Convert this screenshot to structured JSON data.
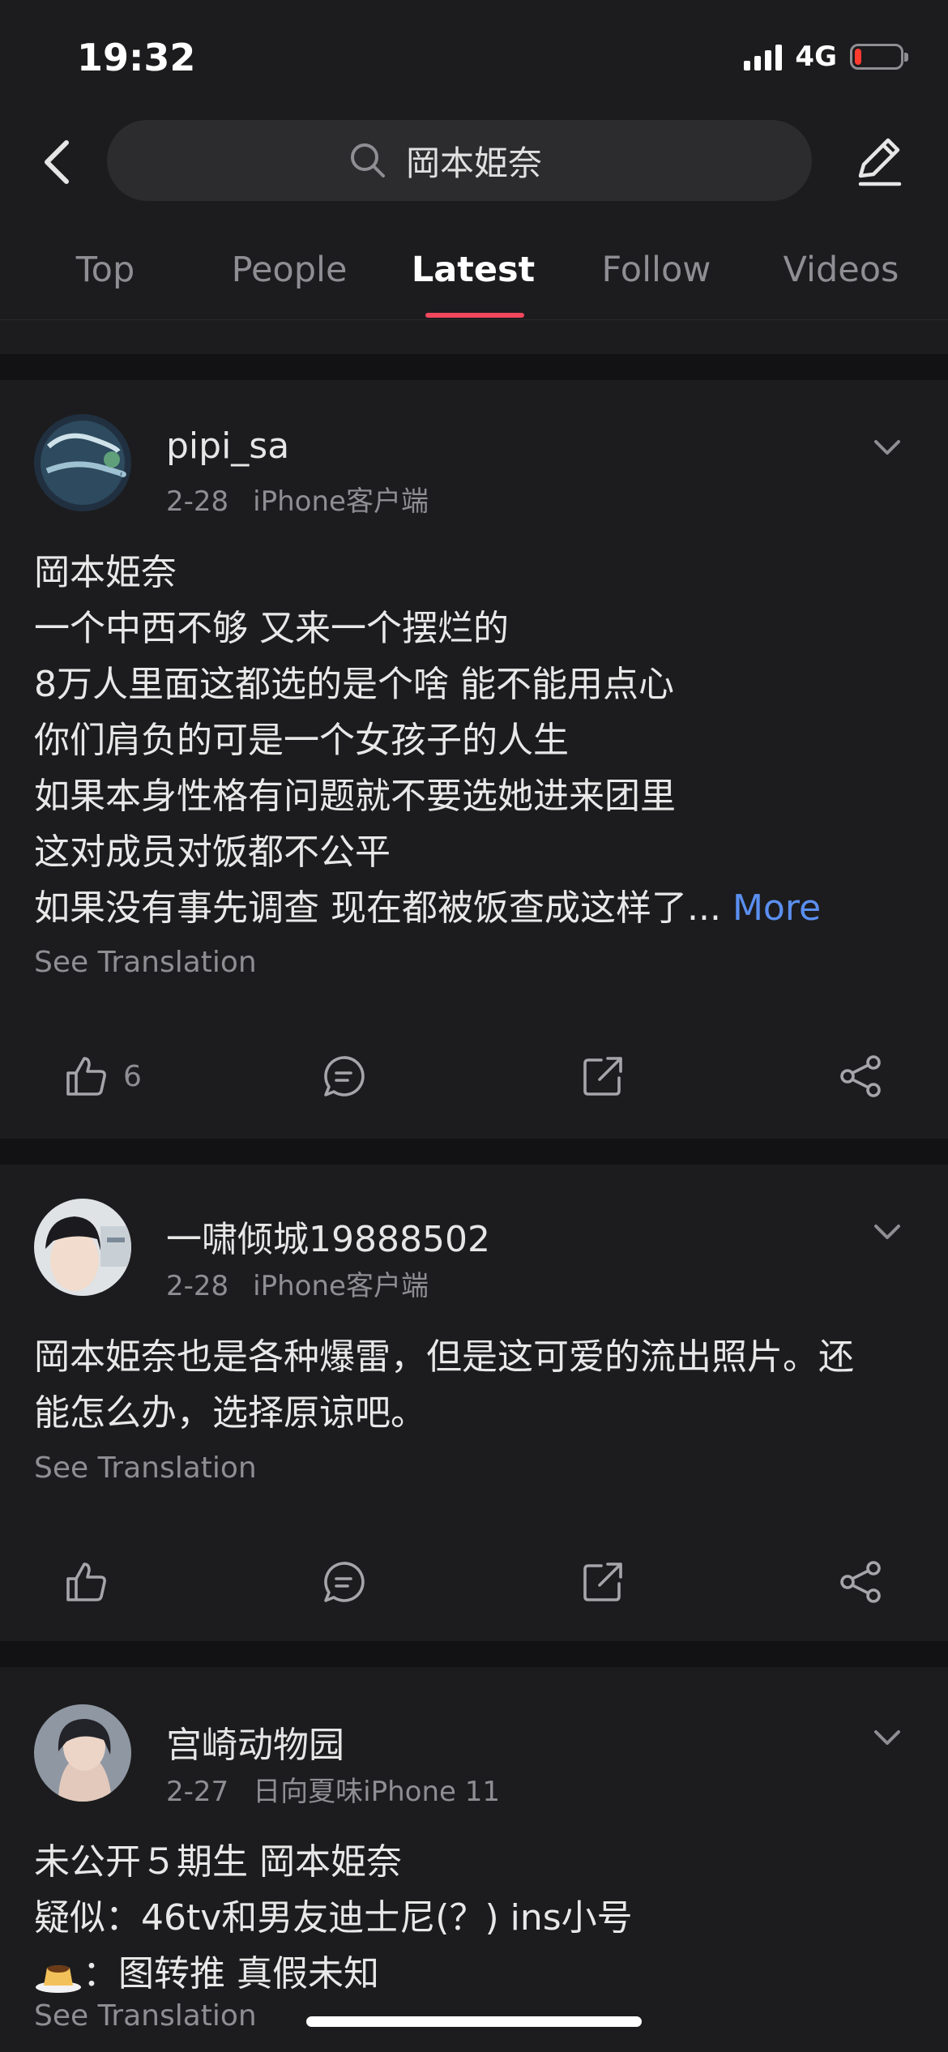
{
  "status_bar": {
    "time": "19:32",
    "network": "4G",
    "battery_level": 0.15
  },
  "search": {
    "query": "岡本姫奈",
    "placeholder": "岡本姫奈",
    "back_icon": "back-arrow-icon",
    "search_icon": "search-icon",
    "compose_icon": "pencil-icon"
  },
  "tabs": [
    {
      "label": "Top"
    },
    {
      "label": "People"
    },
    {
      "label": "Latest",
      "active": true
    },
    {
      "label": "Follow"
    },
    {
      "label": "Videos"
    }
  ],
  "colors": {
    "background": "#1c1c1e",
    "separator": "#121214",
    "tab_active_underline": "#f2475d",
    "link": "#5b8ff0",
    "muted_text": "#8e8e93"
  },
  "posts": [
    {
      "author": "pipi_sa",
      "date": "2-28",
      "source": "iPhone客户端",
      "lines": [
        "岡本姫奈",
        "一个中西不够 又来一个摆烂的",
        "8万人里面这都选的是个啥 能不能用点心",
        "你们肩负的可是一个女孩子的人生",
        "如果本身性格有问题就不要选她进来团里",
        "这对成员对饭都不公平",
        "如果没有事先调查 现在都被饭查成这样了..."
      ],
      "more_label": "More",
      "see_translation": "See Translation",
      "like_count": "6"
    },
    {
      "author": "一啸倾城19888502",
      "date": "2-28",
      "source": "iPhone客户端",
      "lines": [
        "岡本姫奈也是各种爆雷，但是这可爱的流出照片。还",
        "能怎么办，选择原谅吧。"
      ],
      "see_translation": "See Translation",
      "like_count": ""
    },
    {
      "author": "宫崎动物园",
      "date": "2-27",
      "source": "日向夏味iPhone 11",
      "lines": [
        "未公开５期生 岡本姫奈",
        "疑似：46tv和男友迪士尼(？) ins小号",
        "：图转推 真假未知"
      ],
      "line3_emoji": "pudding-emoji",
      "see_translation": "See Translation"
    }
  ],
  "action_icons": [
    "like-icon",
    "comment-icon",
    "repost-icon",
    "share-icon"
  ]
}
